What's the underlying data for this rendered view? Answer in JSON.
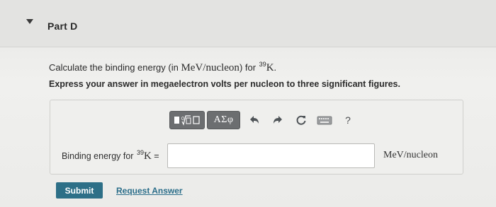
{
  "part": {
    "title": "Part D",
    "caret_icon": "caret-down-icon"
  },
  "question": {
    "prefix": "Calculate the binding energy (in ",
    "unit_expr": "MeV/nucleon",
    "mid": ") for ",
    "isotope_mass_number": "39",
    "isotope_symbol": "K",
    "suffix": "."
  },
  "instruction": "Express your answer in megaelectron volts per nucleon to three significant figures.",
  "toolbar": {
    "templates_icon": "templates-icon",
    "greek_label": "ΑΣφ",
    "undo_icon": "undo-icon",
    "redo_icon": "redo-icon",
    "reset_icon": "reset-icon",
    "keyboard_icon": "keyboard-icon",
    "help_label": "?"
  },
  "answer": {
    "label_prefix": "Binding energy for ",
    "mass_number": "39",
    "symbol": "K",
    "equals": " =",
    "value": "",
    "placeholder": "",
    "unit": "MeV/nucleon"
  },
  "actions": {
    "submit_label": "Submit",
    "request_label": "Request Answer"
  },
  "colors": {
    "submit_bg": "#2d6f87",
    "link": "#2b6e8a",
    "toolbar_btn": "#6c6e70"
  }
}
